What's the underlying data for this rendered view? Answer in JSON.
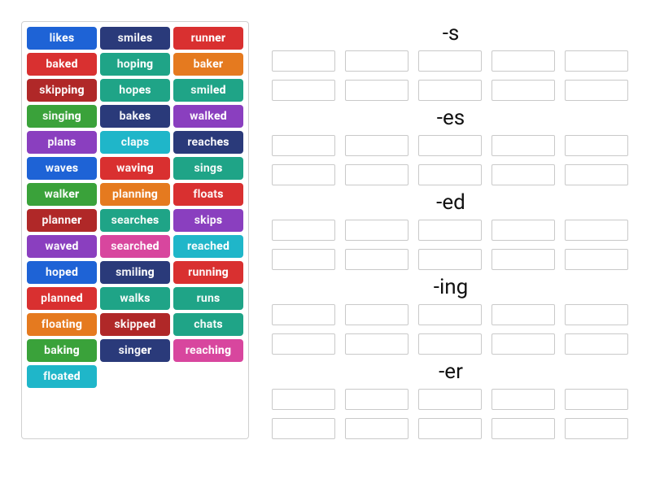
{
  "palette": {
    "blue": "#1e63d6",
    "red": "#d93030",
    "orange": "#e57a1f",
    "teal": "#1fa487",
    "green": "#3aa23a",
    "purple": "#8a3fbf",
    "navy": "#2a3a7a",
    "pink": "#d8469e",
    "cyan": "#1fb6c9",
    "crimson": "#b02828"
  },
  "tiles": [
    {
      "root": "lik",
      "suf": "es",
      "color": "blue"
    },
    {
      "root": "smil",
      "suf": "es",
      "color": "navy"
    },
    {
      "root": "run",
      "suf": "ner",
      "color": "red"
    },
    {
      "root": "bak",
      "suf": "ed",
      "color": "red"
    },
    {
      "root": "hop",
      "suf": "ing",
      "color": "teal"
    },
    {
      "root": "bak",
      "suf": "er",
      "color": "orange"
    },
    {
      "root": "skipp",
      "suf": "ing",
      "color": "crimson"
    },
    {
      "root": "hop",
      "suf": "es",
      "color": "teal"
    },
    {
      "root": "smil",
      "suf": "ed",
      "color": "teal"
    },
    {
      "root": "sing",
      "suf": "ing",
      "color": "green"
    },
    {
      "root": "bak",
      "suf": "es",
      "color": "navy"
    },
    {
      "root": "walk",
      "suf": "ed",
      "color": "purple"
    },
    {
      "root": "plan",
      "suf": "s",
      "color": "purple"
    },
    {
      "root": "clap",
      "suf": "s",
      "color": "cyan"
    },
    {
      "root": "reach",
      "suf": "es",
      "color": "navy"
    },
    {
      "root": "wav",
      "suf": "es",
      "color": "blue"
    },
    {
      "root": "wav",
      "suf": "ing",
      "color": "red"
    },
    {
      "root": "sing",
      "suf": "s",
      "color": "teal"
    },
    {
      "root": "walk",
      "suf": "er",
      "color": "green"
    },
    {
      "root": "plann",
      "suf": "ing",
      "color": "orange"
    },
    {
      "root": "float",
      "suf": "s",
      "color": "red"
    },
    {
      "root": "plann",
      "suf": "er",
      "color": "crimson"
    },
    {
      "root": "search",
      "suf": "es",
      "color": "teal"
    },
    {
      "root": "skip",
      "suf": "s",
      "color": "purple"
    },
    {
      "root": "wav",
      "suf": "ed",
      "color": "purple"
    },
    {
      "root": "search",
      "suf": "ed",
      "color": "pink"
    },
    {
      "root": "reach",
      "suf": "ed",
      "color": "cyan"
    },
    {
      "root": "hop",
      "suf": "ed",
      "color": "blue"
    },
    {
      "root": "smil",
      "suf": "ing",
      "color": "navy"
    },
    {
      "root": "runn",
      "suf": "ing",
      "color": "red"
    },
    {
      "root": "plann",
      "suf": "ed",
      "color": "red"
    },
    {
      "root": "walk",
      "suf": "s",
      "color": "teal"
    },
    {
      "root": "run",
      "suf": "s",
      "color": "teal"
    },
    {
      "root": "float",
      "suf": "ing",
      "color": "orange"
    },
    {
      "root": "skipp",
      "suf": "ed",
      "color": "crimson"
    },
    {
      "root": "chat",
      "suf": "s",
      "color": "teal"
    },
    {
      "root": "bak",
      "suf": "ing",
      "color": "green"
    },
    {
      "root": "sing",
      "suf": "er",
      "color": "navy"
    },
    {
      "root": "reach",
      "suf": "ing",
      "color": "pink"
    },
    {
      "root": "float",
      "suf": "ed",
      "color": "cyan"
    }
  ],
  "groups": [
    {
      "title": "-s",
      "slots": 10
    },
    {
      "title": "-es",
      "slots": 10
    },
    {
      "title": "-ed",
      "slots": 10
    },
    {
      "title": "-ing",
      "slots": 10
    },
    {
      "title": "-er",
      "slots": 10
    }
  ]
}
